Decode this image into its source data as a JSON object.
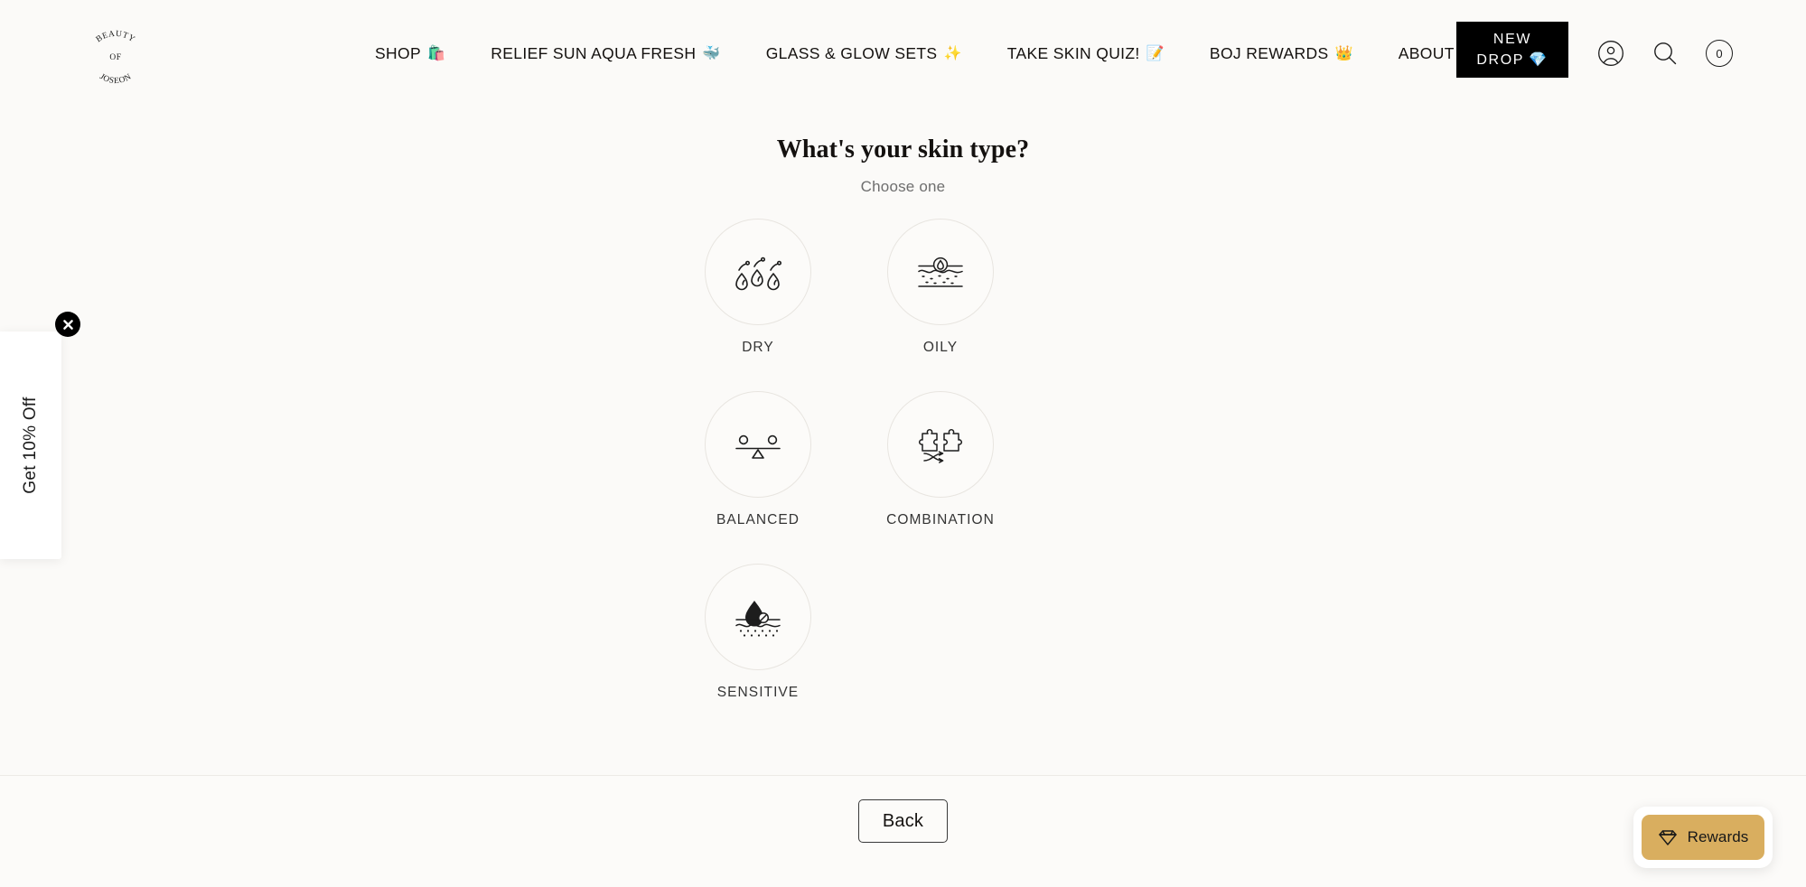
{
  "brand": {
    "logo_line1": "BEAUTY",
    "logo_line2": "OF",
    "logo_line3": "JOSEON"
  },
  "header": {
    "nav": [
      {
        "label": "SHOP",
        "emoji": "🛍️",
        "name": "nav-item-shop"
      },
      {
        "label": "RELIEF SUN AQUA FRESH",
        "emoji": "🐳",
        "name": "nav-item-relief-sun-aqua-fresh"
      },
      {
        "label": "GLASS & GLOW SETS",
        "emoji": "✨",
        "name": "nav-item-glass-and-glow-sets"
      },
      {
        "label": "TAKE SKIN QUIZ!",
        "emoji": "📝",
        "name": "nav-item-take-skin-quiz"
      },
      {
        "label": "BOJ REWARDS",
        "emoji": "👑",
        "name": "nav-item-boj-rewards"
      },
      {
        "label": "ABOUT",
        "emoji": "",
        "name": "nav-item-about"
      }
    ],
    "new_drop_line1": "NEW",
    "new_drop_line2": "DROP",
    "new_drop_emoji": "💎",
    "cart_count": "0",
    "icons": {
      "account": "account-icon",
      "search": "search-icon",
      "cart": "cart-count-badge"
    }
  },
  "quiz": {
    "title": "What's your skin type?",
    "subtitle": "Choose one",
    "options": [
      {
        "label": "DRY",
        "icon": "water-droplets-icon",
        "name": "quiz-option-dry"
      },
      {
        "label": "OILY",
        "icon": "oily-skin-layers-icon",
        "name": "quiz-option-oily"
      },
      {
        "label": "BALANCED",
        "icon": "balance-scale-icon",
        "name": "quiz-option-balanced"
      },
      {
        "label": "COMBINATION",
        "icon": "puzzle-pieces-icon",
        "name": "quiz-option-combination"
      },
      {
        "label": "SENSITIVE",
        "icon": "no-water-skin-layers-icon",
        "name": "quiz-option-sensitive"
      }
    ]
  },
  "footer": {
    "back_label": "Back"
  },
  "promo": {
    "text": "Get 10% Off",
    "close_glyph": "✕"
  },
  "rewards": {
    "label": "Rewards",
    "icon": "gem-icon",
    "accent_color": "#d9ae5f"
  },
  "colors": {
    "background": "#fbfaf8",
    "text": "#14110f",
    "muted_text": "#6e6e6e",
    "circle_border": "#e8e5e0",
    "new_drop_bg": "#000000",
    "rewards_gold": "#d9ae5f"
  }
}
